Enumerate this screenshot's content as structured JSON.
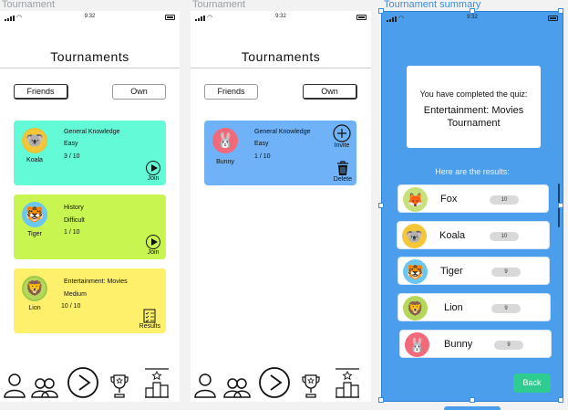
{
  "frames": {
    "left_label": "Tournament",
    "middle_label": "Tournament",
    "right_label": "Tournament summary"
  },
  "status": {
    "time": "9:32"
  },
  "screen1": {
    "title": "Tournaments",
    "tabs": {
      "friends": "Friends",
      "own": "Own"
    },
    "cards": [
      {
        "name": "Koala",
        "topic": "General Knowledge",
        "difficulty": "Easy",
        "progress": "3 / 10",
        "action": "Join",
        "color": "#63fad8",
        "avatar": "🐨"
      },
      {
        "name": "Tiger",
        "topic": "History",
        "difficulty": "Difficult",
        "progress": "1 / 10",
        "action": "Join",
        "color": "#c8f550",
        "avatar": "🐯"
      },
      {
        "name": "Lion",
        "topic": "Entertainment: Movies",
        "difficulty": "Medium",
        "progress": "10 / 10",
        "action": "Results",
        "color": "#fef06b",
        "avatar": "🦁"
      }
    ]
  },
  "screen2": {
    "title": "Tournaments",
    "tabs": {
      "friends": "Friends",
      "own": "Own"
    },
    "card": {
      "name": "Bunny",
      "topic": "General Knowledge",
      "difficulty": "Easy",
      "progress": "1 / 10",
      "invite": "Invite",
      "delete": "Delete",
      "color": "#6fb2f7",
      "avatar": "🐰"
    }
  },
  "screen3": {
    "completed_text": "You have completed the quiz:",
    "quiz_name": "Entertainment: Movies Tournament",
    "results_label": "Here are the results:",
    "results": [
      {
        "name": "Fox",
        "score": "10",
        "avatar": "🦊"
      },
      {
        "name": "Koala",
        "score": "10",
        "avatar": "🐨"
      },
      {
        "name": "Tiger",
        "score": "9",
        "avatar": "🐯"
      },
      {
        "name": "Lion",
        "score": "9",
        "avatar": "🦁"
      },
      {
        "name": "Bunny",
        "score": "9",
        "avatar": "🐰"
      }
    ],
    "back": "Back"
  },
  "icons": {
    "profile": "person-icon",
    "friends": "people-icon",
    "play": "play-icon",
    "trophy": "trophy-icon",
    "leaderboard": "podium-icon"
  }
}
